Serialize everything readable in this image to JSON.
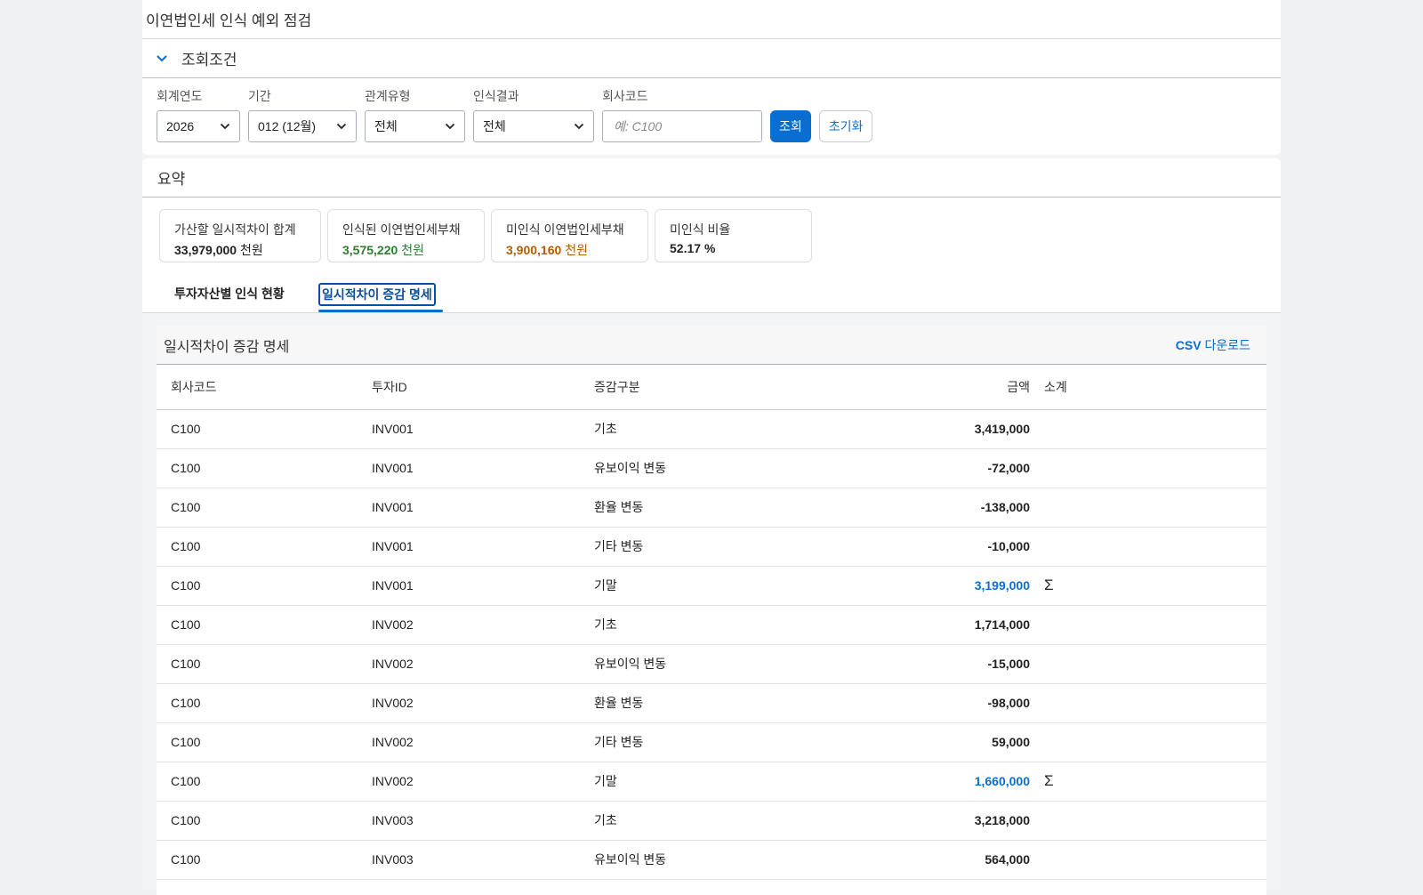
{
  "title": "이연법인세 인식 예외 점검",
  "filters_panel": {
    "label": "조회조건"
  },
  "filters": {
    "year": {
      "label": "회계연도",
      "value": "2026"
    },
    "period": {
      "label": "기간",
      "value": "012 (12월)"
    },
    "relation": {
      "label": "관계유형",
      "value": "전체"
    },
    "result": {
      "label": "인식결과",
      "value": "전체"
    },
    "company": {
      "label": "회사코드",
      "placeholder": "예: C100"
    },
    "search_button": "조회",
    "reset_button": "초기화"
  },
  "summary": {
    "label": "요약",
    "kpis": [
      {
        "title": "가산할 일시적차이 합계",
        "value": "33,979,000",
        "unit": "천원",
        "color": "#222222"
      },
      {
        "title": "인식된 이연법인세부채",
        "value": "3,575,220",
        "unit": "천원",
        "color": "#2e7d32"
      },
      {
        "title": "미인식 이연법인세부채",
        "value": "3,900,160",
        "unit": "천원",
        "color": "#b25e00"
      },
      {
        "title": "미인식 비율",
        "value": "52.17",
        "unit": "%",
        "color": "#222222"
      }
    ]
  },
  "tabs": [
    {
      "label": "투자자산별 인식 현황",
      "active": false
    },
    {
      "label": "일시적차이 증감 명세",
      "active": true
    }
  ],
  "table": {
    "title": "일시적차이 증감 명세",
    "csv_prefix": "CSV",
    "csv_suffix": "다운로드",
    "columns": [
      "회사코드",
      "투자ID",
      "증감구분",
      "금액",
      "소계"
    ],
    "sigma": "Σ",
    "rows": [
      {
        "company": "C100",
        "inv": "INV001",
        "type": "기초",
        "amount": "3,419,000",
        "end": false
      },
      {
        "company": "C100",
        "inv": "INV001",
        "type": "유보이익 변동",
        "amount": "-72,000",
        "end": false
      },
      {
        "company": "C100",
        "inv": "INV001",
        "type": "환율 변동",
        "amount": "-138,000",
        "end": false
      },
      {
        "company": "C100",
        "inv": "INV001",
        "type": "기타 변동",
        "amount": "-10,000",
        "end": false
      },
      {
        "company": "C100",
        "inv": "INV001",
        "type": "기말",
        "amount": "3,199,000",
        "end": true
      },
      {
        "company": "C100",
        "inv": "INV002",
        "type": "기초",
        "amount": "1,714,000",
        "end": false
      },
      {
        "company": "C100",
        "inv": "INV002",
        "type": "유보이익 변동",
        "amount": "-15,000",
        "end": false
      },
      {
        "company": "C100",
        "inv": "INV002",
        "type": "환율 변동",
        "amount": "-98,000",
        "end": false
      },
      {
        "company": "C100",
        "inv": "INV002",
        "type": "기타 변동",
        "amount": "59,000",
        "end": false
      },
      {
        "company": "C100",
        "inv": "INV002",
        "type": "기말",
        "amount": "1,660,000",
        "end": true
      },
      {
        "company": "C100",
        "inv": "INV003",
        "type": "기초",
        "amount": "3,218,000",
        "end": false
      },
      {
        "company": "C100",
        "inv": "INV003",
        "type": "유보이익 변동",
        "amount": "564,000",
        "end": false
      }
    ]
  }
}
